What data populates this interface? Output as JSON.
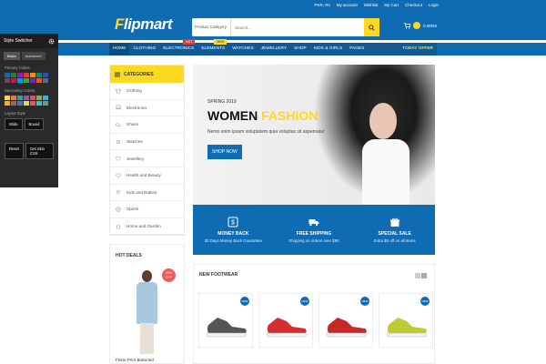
{
  "header": {
    "toplinks": [
      "PKR, Rs",
      "My account",
      "Wishlist",
      "My Cart",
      "Checkout",
      "Login"
    ],
    "logo_main": "lipmart",
    "logo_f": "F",
    "search_category": "Product Category",
    "search_placeholder": "Search...",
    "cart_amount": "0.00RS"
  },
  "nav": {
    "items": [
      "HOME",
      "CLOTHING",
      "ELECTRONICS",
      "ELEMENTS",
      "WATCHES",
      "JEWELLERY",
      "SHOP",
      "KIDS & GIRLS",
      "PAGES"
    ],
    "hot_tag": "HOT",
    "new_tag": "NEW",
    "deal": "TODAY OFFER"
  },
  "switcher": {
    "title": "Style Switcher",
    "tabs": [
      "Basic",
      "Advanced"
    ],
    "primary_label": "Primary Colors",
    "secondary_label": "Secondary Colors",
    "layout_label": "Layout Style",
    "layout_buttons": [
      "Wide",
      "Boxed"
    ],
    "action_buttons": [
      "Reset",
      "Get Skin CSS"
    ],
    "primary_colors": [
      "#0f6cb2",
      "#2e7d32",
      "#8e24aa",
      "#e53935",
      "#fb8c00",
      "#00897b",
      "#3949ab",
      "#6d4c41",
      "#c2185b",
      "#039be5",
      "#43a047",
      "#5e35b1",
      "#f4511e",
      "#546e7a"
    ],
    "secondary_colors": [
      "#fdd922",
      "#ff7043",
      "#26a69a",
      "#ab47bc",
      "#ec407a",
      "#7cb342",
      "#29b6f6",
      "#ffa726",
      "#8d6e63",
      "#5c6bc0",
      "#d4e157",
      "#ef5350",
      "#26c6da",
      "#78909c"
    ]
  },
  "categories": {
    "title": "CATEGORIES",
    "items": [
      "Clothing",
      "Electronics",
      "Shoes",
      "Watches",
      "Jewellery",
      "Health and Beauty",
      "Kids and Babies",
      "Sports",
      "Home and Garden"
    ]
  },
  "hero": {
    "season": "SPRING 2019",
    "title_a": "WOMEN ",
    "title_b": "FASHION",
    "text": "Nemo enim ipsam voluptatem quia voluptas sit aspernatur",
    "button": "SHOP NOW"
  },
  "info": [
    {
      "title": "MONEY BACK",
      "text": "30 Days Money Back Guarantee"
    },
    {
      "title": "FREE SHIPPING",
      "text": "Shipping on orders over $99"
    },
    {
      "title": "SPECIAL SALE",
      "text": "Extra $5 off on all items"
    }
  ],
  "hot_deals": {
    "title": "HOT DEALS",
    "discount": "20% OFF",
    "product": "Floral Print Buttoned"
  },
  "new_footwear": {
    "title": "NEW FOOTWEAR",
    "badge": "NEW",
    "shoe_colors": [
      "#555",
      "#d32f2f",
      "#c62828",
      "#c0ca33"
    ]
  }
}
